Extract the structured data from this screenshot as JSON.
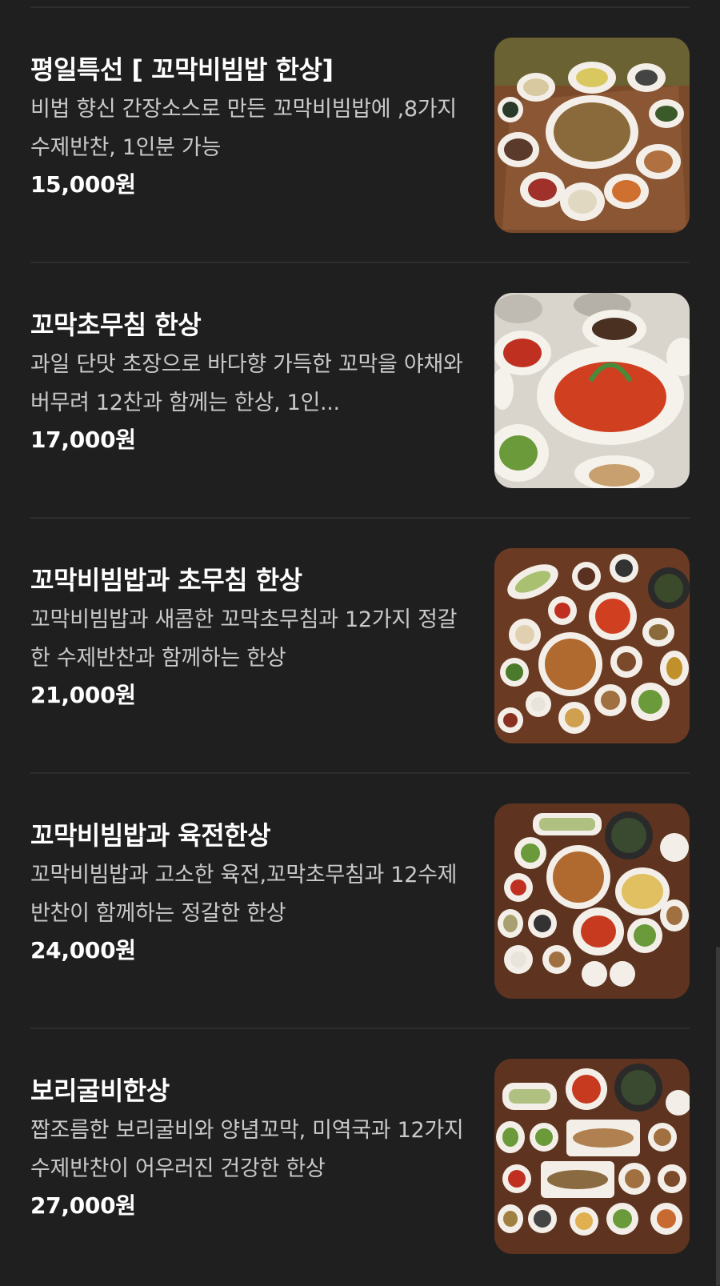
{
  "menu": {
    "items": [
      {
        "name": "평일특선 [ 꼬막비빔밥 한상]",
        "description": "비법 향신 간장소스로 만든 꼬막비빔밥에 ,8가지 수제반찬, 1인분 가능",
        "price": "15,000원",
        "photo_icon": "food-photo"
      },
      {
        "name": "꼬막초무침 한상",
        "description": "과일 단맛 초장으로 바다향 가득한 꼬막을 야채와 버무려 12찬과 함께는 한상, 1인...",
        "price": "17,000원",
        "photo_icon": "food-photo"
      },
      {
        "name": "꼬막비빔밥과 초무침 한상",
        "description": "꼬막비빔밥과 새콤한 꼬막초무침과 12가지 정갈한 수제반찬과 함께하는 한상",
        "price": "21,000원",
        "photo_icon": "food-photo"
      },
      {
        "name": "꼬막비빔밥과 육전한상",
        "description": "꼬막비빔밥과 고소한 육전,꼬막초무침과 12수제반찬이 함께하는 정갈한 한상",
        "price": "24,000원",
        "photo_icon": "food-photo"
      },
      {
        "name": "보리굴비한상",
        "description": "짭조름한 보리굴비와 양념꼬막, 미역국과 12가지 수제반찬이 어우러진 건강한 한상",
        "price": "27,000원",
        "photo_icon": "food-photo"
      }
    ]
  },
  "colors": {
    "background": "#1f1f1f",
    "divider": "#2e2e2e",
    "description_text": "#c9c9c9",
    "table_wood": "#6b3a22"
  }
}
